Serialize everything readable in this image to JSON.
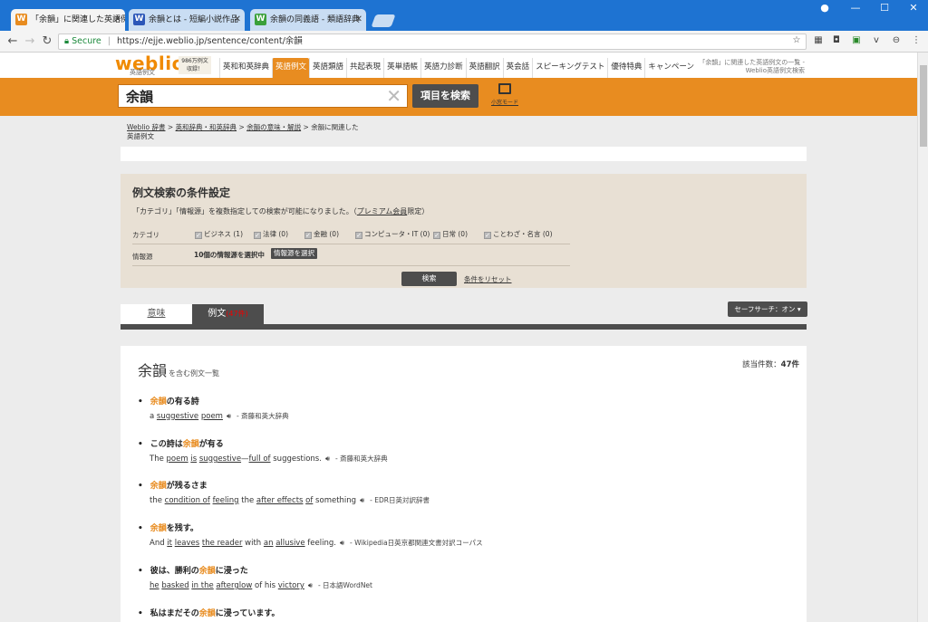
{
  "browser": {
    "tabs": [
      {
        "favicon": "W",
        "favicon_color": "#e88c20",
        "title": "「余韻」に関連した英語例文",
        "active": true
      },
      {
        "favicon": "W",
        "favicon_color": "#2b56b8",
        "title": "余韻とは - 短編小説作品",
        "active": false
      },
      {
        "favicon": "W",
        "favicon_color": "#3aa03a",
        "title": "余韻の同義語 - 類語辞典",
        "active": false
      }
    ],
    "secure_label": "Secure",
    "url": "https://ejje.weblio.jp/sentence/content/余韻",
    "extension_badge": "1"
  },
  "header": {
    "logo": "weblio",
    "logo_sub": "英語例文",
    "badge_line1": "986万例文",
    "badge_line2": "収録！",
    "nav": [
      "英和和英辞典",
      "英語例文",
      "英語類語",
      "共起表現",
      "英単語帳",
      "英語力診断",
      "英語翻訳",
      "英会話",
      "スピーキングテスト",
      "優待特典",
      "キャンペーン"
    ],
    "nav_active_index": 1,
    "right_text": "「余韻」に関連した英語例文の一覧 - Weblio英語例文検索"
  },
  "search": {
    "query": "余韻",
    "button": "項目を検索",
    "small_mode": "小窓モード"
  },
  "breadcrumb": {
    "items": [
      "Weblio 辞書",
      "英和辞典・和英辞典",
      "余韻の意味・解説",
      "余韻に関連した英語例文"
    ],
    "sep": " > "
  },
  "conditions": {
    "title": "例文検索の条件設定",
    "desc_prefix": "「カテゴリ」「情報源」を複数指定しての検索が可能になりました。（",
    "desc_link": "プレミアム会員",
    "desc_suffix": "限定）",
    "category_label": "カテゴリ",
    "categories": [
      "ビジネス (1)",
      "法律 (0)",
      "金融 (0)",
      "コンピュータ・IT (0)",
      "日常 (0)",
      "ことわざ・名言 (0)"
    ],
    "source_label": "情報源",
    "source_info": "10個の情報源を選択中",
    "source_button": "情報源を選択",
    "search_button": "検索",
    "reset_link": "条件をリセット"
  },
  "tabs": {
    "meaning": "意味",
    "examples": "例文",
    "examples_count": "(47件)",
    "safesearch": "セーフサーチ：オン ▾"
  },
  "results": {
    "keyword": "余韻",
    "subtitle": "を含む例文一覧",
    "hits_label": "該当件数：",
    "hits": "47件",
    "entries": [
      {
        "jp_pre": "",
        "jp_hl": "余韻",
        "jp_post": "の有る詩",
        "en_parts": [
          [
            "a ",
            false
          ],
          [
            "suggestive",
            true
          ],
          [
            " ",
            false
          ],
          [
            "poem",
            true
          ]
        ],
        "src": "- 斎藤和英大辞典"
      },
      {
        "jp_pre": "この詩は",
        "jp_hl": "余韻",
        "jp_post": "が有る",
        "en_parts": [
          [
            "The ",
            false
          ],
          [
            "poem",
            true
          ],
          [
            " ",
            false
          ],
          [
            "is",
            true
          ],
          [
            " ",
            false
          ],
          [
            "suggestive",
            true
          ],
          [
            "—",
            false
          ],
          [
            "full of",
            true
          ],
          [
            " suggestions.",
            false
          ]
        ],
        "src": "- 斎藤和英大辞典"
      },
      {
        "jp_pre": "",
        "jp_hl": "余韻",
        "jp_post": "が残るさま",
        "en_parts": [
          [
            "the ",
            false
          ],
          [
            "condition of",
            true
          ],
          [
            " ",
            false
          ],
          [
            "feeling",
            true
          ],
          [
            " the ",
            false
          ],
          [
            "after effects",
            true
          ],
          [
            " ",
            false
          ],
          [
            "of",
            true
          ],
          [
            " something",
            false
          ]
        ],
        "src": "- EDR日英対訳辞書"
      },
      {
        "jp_pre": "",
        "jp_hl": "余韻",
        "jp_post": "を残す。",
        "en_parts": [
          [
            "And ",
            false
          ],
          [
            "it",
            true
          ],
          [
            " ",
            false
          ],
          [
            "leaves",
            true
          ],
          [
            " ",
            false
          ],
          [
            "the reader",
            true
          ],
          [
            " with ",
            false
          ],
          [
            "an",
            true
          ],
          [
            " ",
            false
          ],
          [
            "allusive",
            true
          ],
          [
            " feeling.",
            false
          ]
        ],
        "src": "- Wikipedia日英京都関連文書対訳コーパス"
      },
      {
        "jp_pre": "彼は、勝利の",
        "jp_hl": "余韻",
        "jp_post": "に浸った",
        "en_parts": [
          [
            "he",
            true
          ],
          [
            " ",
            false
          ],
          [
            "basked",
            true
          ],
          [
            " ",
            false
          ],
          [
            "in the",
            true
          ],
          [
            " ",
            false
          ],
          [
            "afterglow",
            true
          ],
          [
            " of his ",
            false
          ],
          [
            "victory",
            true
          ]
        ],
        "src": "- 日本語WordNet"
      },
      {
        "jp_pre": "私はまだその",
        "jp_hl": "余韻",
        "jp_post": "に浸っています。",
        "en_parts": [],
        "src": ""
      }
    ]
  }
}
